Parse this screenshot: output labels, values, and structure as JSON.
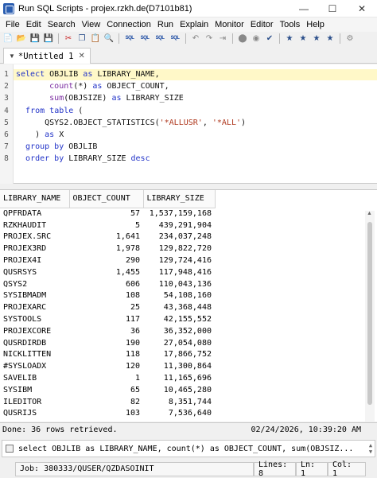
{
  "window": {
    "title": "Run SQL Scripts - projex.rzkh.de(D7101b81)"
  },
  "menu": [
    "File",
    "Edit",
    "Search",
    "View",
    "Connection",
    "Run",
    "Explain",
    "Monitor",
    "Editor",
    "Tools",
    "Help"
  ],
  "toolbar_sql_labels": [
    "SQL",
    "SQL",
    "SQL",
    "SQL"
  ],
  "tab": {
    "label": "*Untitled 1"
  },
  "editor": {
    "line_numbers": [
      "1",
      "2",
      "3",
      "4",
      "5",
      "6",
      "7",
      "8"
    ],
    "lines": [
      [
        {
          "t": "select",
          "c": "kw"
        },
        {
          "t": " OBJLIB ",
          "c": ""
        },
        {
          "t": "as",
          "c": "kw"
        },
        {
          "t": " LIBRARY_NAME,",
          "c": ""
        }
      ],
      [
        {
          "t": "       ",
          "c": ""
        },
        {
          "t": "count",
          "c": "fn"
        },
        {
          "t": "(*) ",
          "c": ""
        },
        {
          "t": "as",
          "c": "kw"
        },
        {
          "t": " OBJECT_COUNT,",
          "c": ""
        }
      ],
      [
        {
          "t": "       ",
          "c": ""
        },
        {
          "t": "sum",
          "c": "fn"
        },
        {
          "t": "(OBJSIZE) ",
          "c": ""
        },
        {
          "t": "as",
          "c": "kw"
        },
        {
          "t": " LIBRARY_SIZE",
          "c": ""
        }
      ],
      [
        {
          "t": "  ",
          "c": ""
        },
        {
          "t": "from",
          "c": "kw"
        },
        {
          "t": " ",
          "c": ""
        },
        {
          "t": "table",
          "c": "kw"
        },
        {
          "t": " (",
          "c": ""
        }
      ],
      [
        {
          "t": "      QSYS2.OBJECT_STATISTICS(",
          "c": ""
        },
        {
          "t": "'*ALLUSR'",
          "c": "str"
        },
        {
          "t": ", ",
          "c": ""
        },
        {
          "t": "'*ALL'",
          "c": "str"
        },
        {
          "t": ")",
          "c": ""
        }
      ],
      [
        {
          "t": "    ) ",
          "c": ""
        },
        {
          "t": "as",
          "c": "kw"
        },
        {
          "t": " X",
          "c": ""
        }
      ],
      [
        {
          "t": "  ",
          "c": ""
        },
        {
          "t": "group by",
          "c": "kw"
        },
        {
          "t": " OBJLIB",
          "c": ""
        }
      ],
      [
        {
          "t": "  ",
          "c": ""
        },
        {
          "t": "order by",
          "c": "kw"
        },
        {
          "t": " LIBRARY_SIZE ",
          "c": ""
        },
        {
          "t": "desc",
          "c": "kw"
        }
      ]
    ]
  },
  "results": {
    "columns": [
      "LIBRARY_NAME",
      "OBJECT_COUNT",
      "LIBRARY_SIZE"
    ],
    "rows": [
      [
        "QPFRDATA",
        "57",
        "1,537,159,168"
      ],
      [
        "RZKHAUDIT",
        "5",
        "439,291,904"
      ],
      [
        "PROJEX.SRC",
        "1,641",
        "234,037,248"
      ],
      [
        "PROJEX3RD",
        "1,978",
        "129,822,720"
      ],
      [
        "PROJEX4I",
        "290",
        "129,724,416"
      ],
      [
        "QUSRSYS",
        "1,455",
        "117,948,416"
      ],
      [
        "QSYS2",
        "606",
        "110,043,136"
      ],
      [
        "SYSIBMADM",
        "108",
        "54,108,160"
      ],
      [
        "PROJEXARC",
        "25",
        "43,368,448"
      ],
      [
        "SYSTOOLS",
        "117",
        "42,155,552"
      ],
      [
        "PROJEXCORE",
        "36",
        "36,352,000"
      ],
      [
        "QUSRDIRDB",
        "190",
        "27,054,080"
      ],
      [
        "NICKLITTEN",
        "118",
        "17,866,752"
      ],
      [
        "#SYSLOADX",
        "120",
        "11,300,864"
      ],
      [
        "SAVELIB",
        "1",
        "11,165,696"
      ],
      [
        "SYSIBM",
        "65",
        "10,465,280"
      ],
      [
        "ILEDITOR",
        "82",
        "8,351,744"
      ],
      [
        "QUSRIJS",
        "103",
        "7,536,640"
      ]
    ]
  },
  "status": {
    "done": "Done: 36 rows retrieved.",
    "timestamp": "02/24/2026, 10:39:20 AM"
  },
  "message": {
    "text": "select OBJLIB as LIBRARY_NAME, count(*) as OBJECT_COUNT, sum(OBJSIZ..."
  },
  "jobbar": {
    "job": "Job: 380333/QUSER/QZDASOINIT",
    "lines": "Lines: 8",
    "ln": "Ln: 1",
    "col": "Col: 1"
  }
}
